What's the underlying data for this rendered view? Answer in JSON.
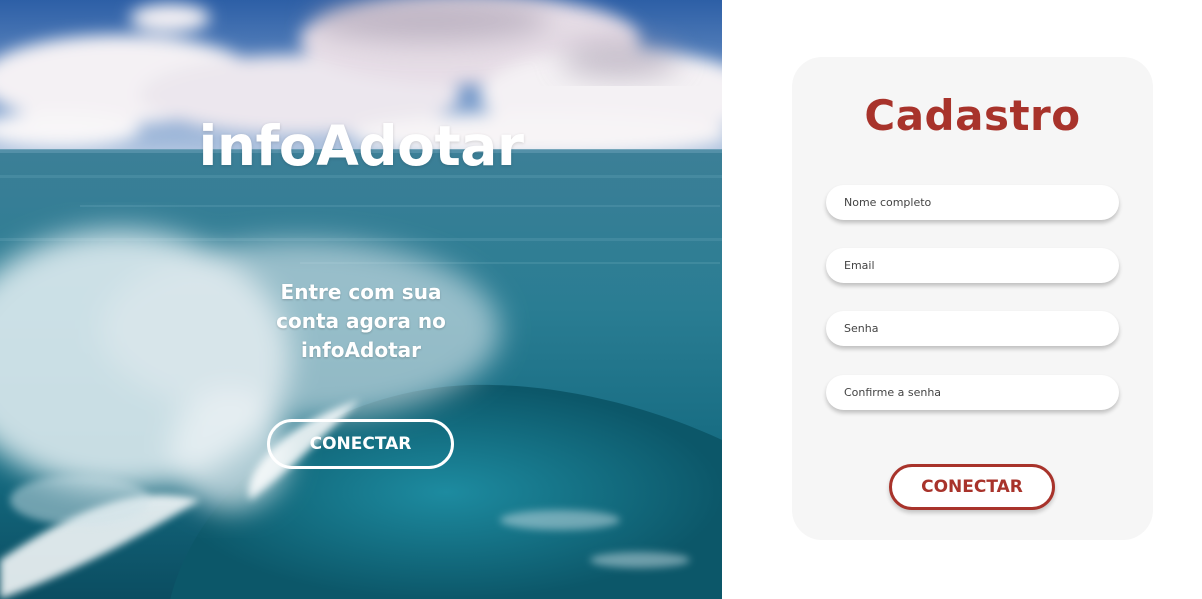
{
  "hero": {
    "title": "infoAdotar",
    "text": "Entre com sua conta agora no infoAdotar",
    "button_label": "CONECTAR"
  },
  "signup": {
    "title": "Cadastro",
    "fields": [
      {
        "placeholder": "Nome completo"
      },
      {
        "placeholder": "Email"
      },
      {
        "placeholder": "Senha"
      },
      {
        "placeholder": "Confirme a senha"
      }
    ],
    "button_label": "CONECTAR"
  },
  "colors": {
    "accent": "#a8332b",
    "card_bg": "#f6f6f6"
  }
}
